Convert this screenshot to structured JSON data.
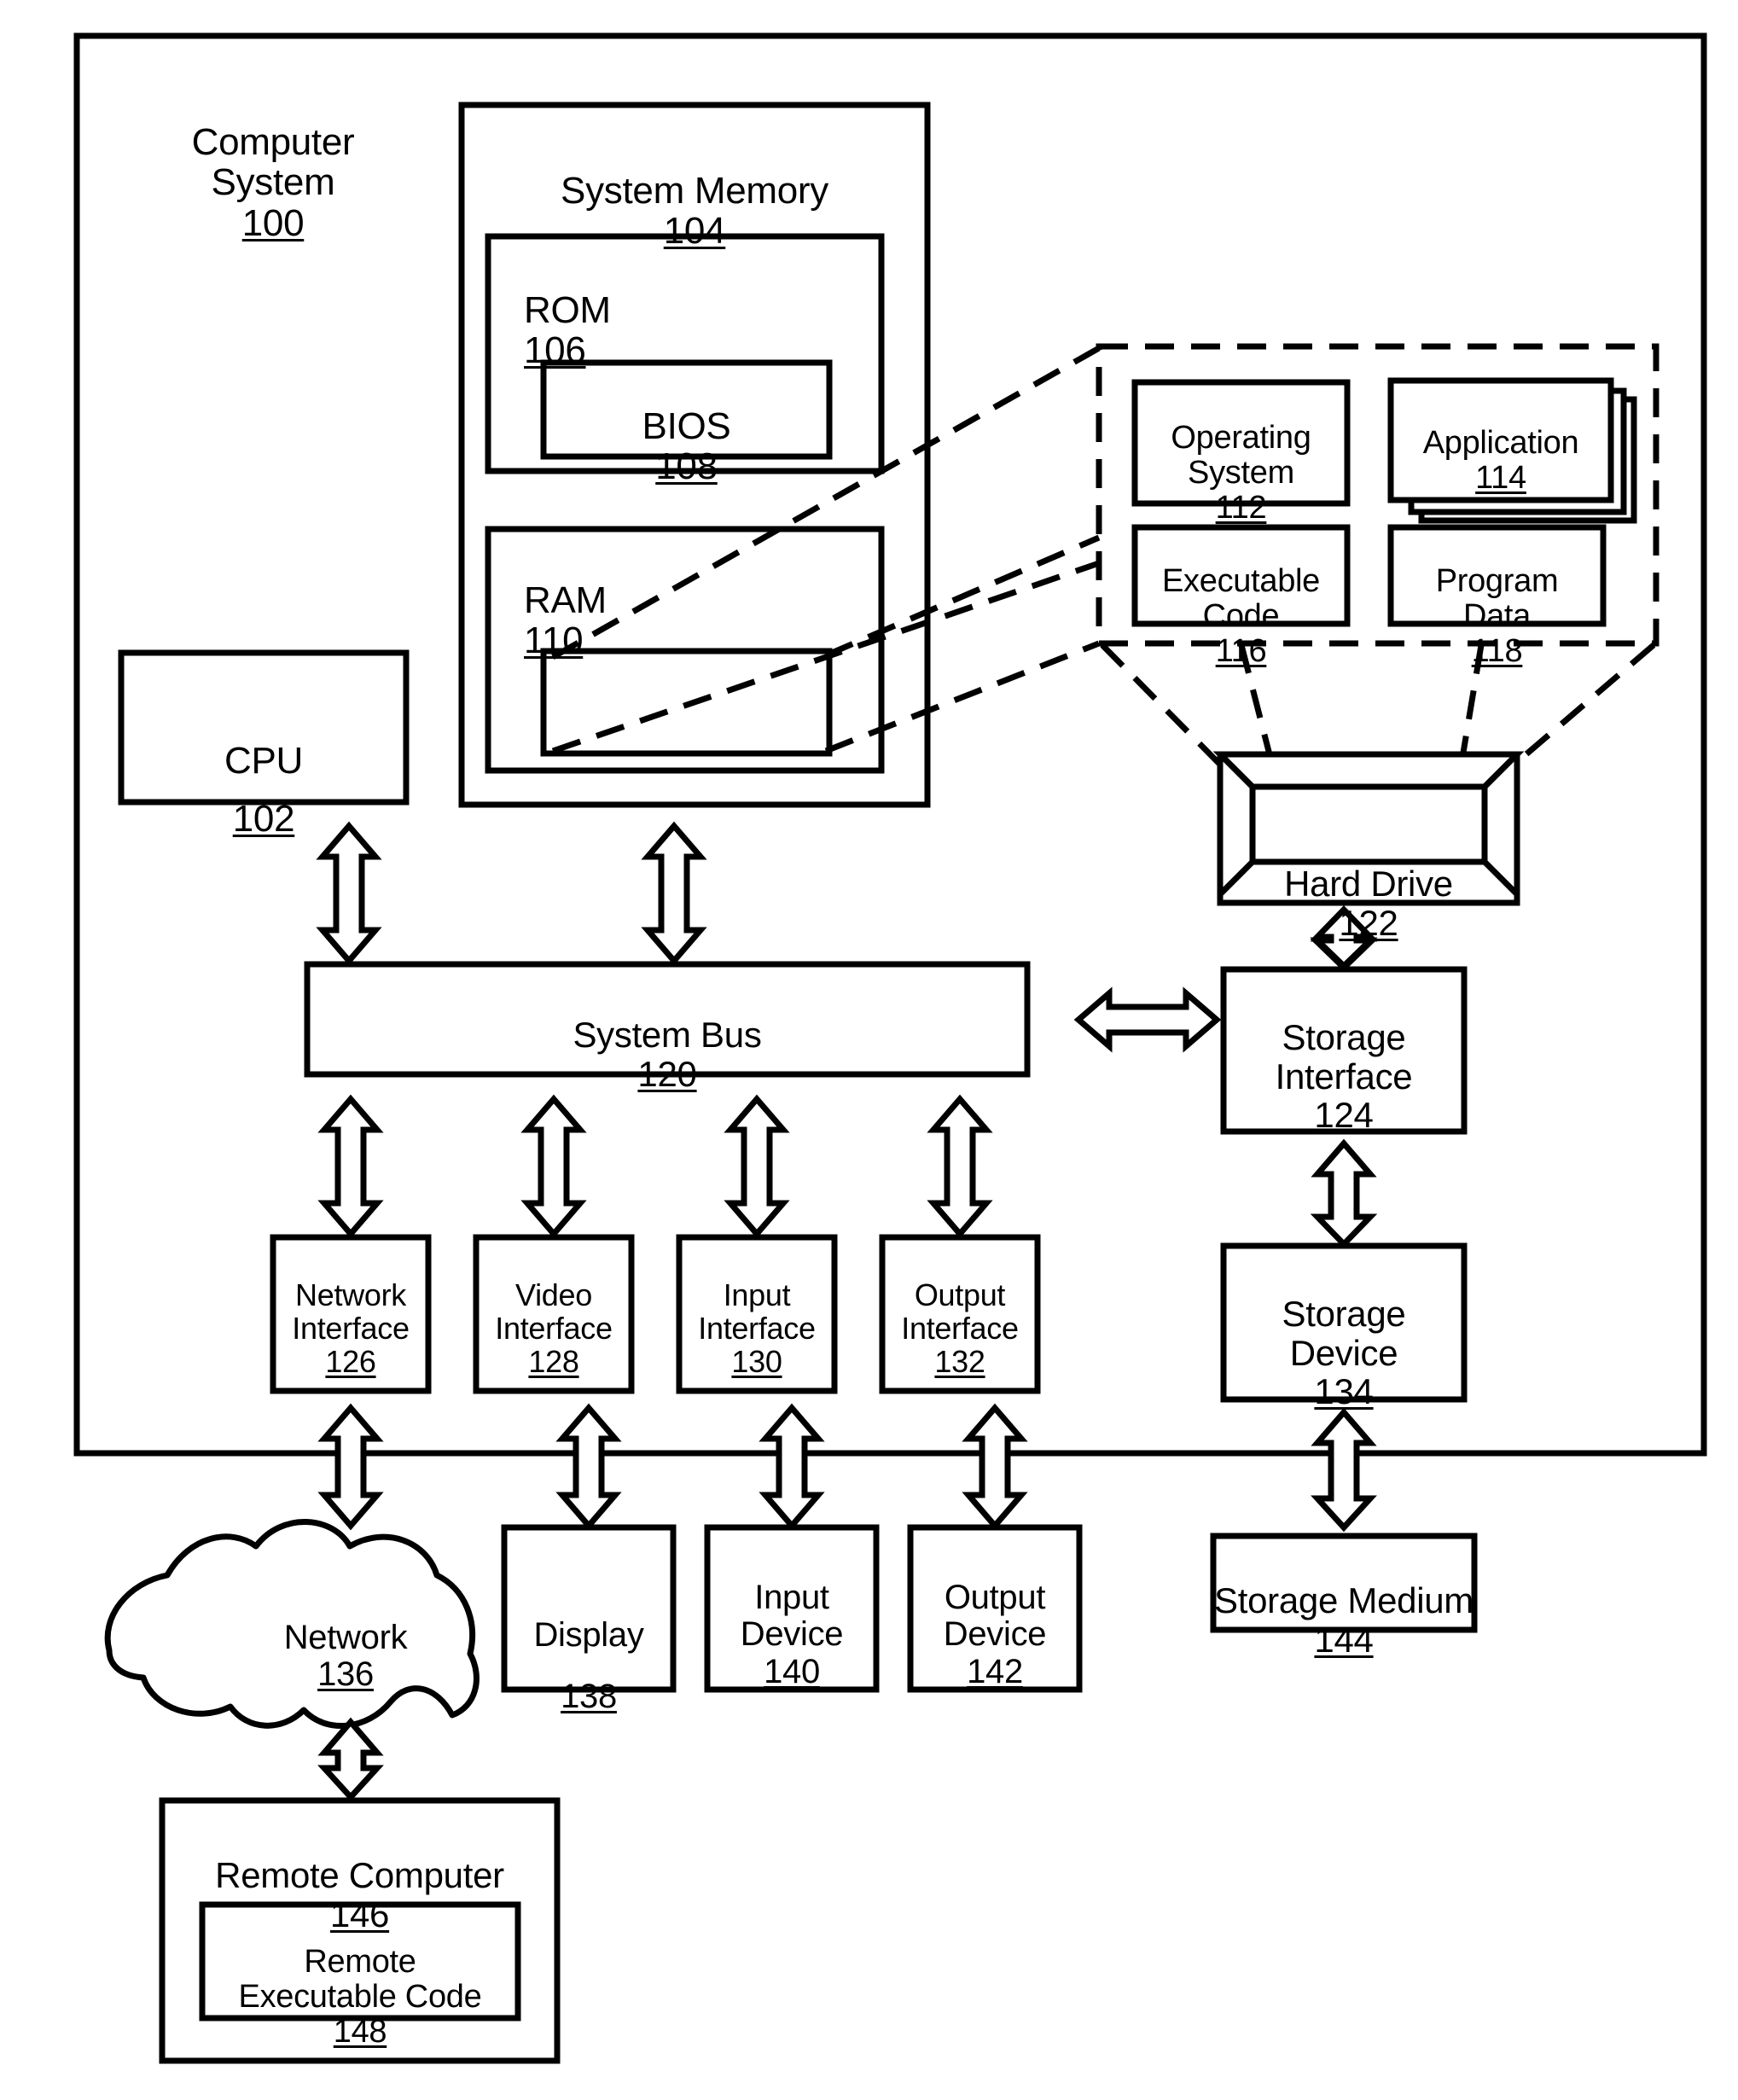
{
  "figure": {
    "type": "patent-block-diagram",
    "title": "Computer System block diagram",
    "line_color": "#000000",
    "background_color": "#ffffff"
  },
  "outer": {
    "label": "Computer System",
    "number": "100"
  },
  "system_memory": {
    "label": "System Memory",
    "number": "104",
    "rom": {
      "label": "ROM",
      "number": "106",
      "bios": {
        "label": "BIOS",
        "number": "108"
      }
    },
    "ram": {
      "label": "RAM",
      "number": "110",
      "inner": {
        "label": "",
        "number": ""
      }
    }
  },
  "cpu": {
    "label": "CPU",
    "number": "102"
  },
  "callout": {
    "operating_system": {
      "label": "Operating\nSystem",
      "number": "112"
    },
    "application": {
      "label": "Application",
      "number": "114"
    },
    "executable_code": {
      "label": "Executable\nCode",
      "number": "116"
    },
    "program_data": {
      "label": "Program\nData",
      "number": "118"
    }
  },
  "hard_drive": {
    "label": "Hard Drive",
    "number": "122"
  },
  "system_bus": {
    "label": "System Bus",
    "number": "120"
  },
  "storage_interface": {
    "label": "Storage\nInterface",
    "number": "124"
  },
  "storage_device": {
    "label": "Storage\nDevice",
    "number": "134"
  },
  "storage_medium": {
    "label": "Storage Medium",
    "number": "144"
  },
  "interfaces": [
    {
      "label": "Network\nInterface",
      "number": "126"
    },
    {
      "label": "Video\nInterface",
      "number": "128"
    },
    {
      "label": "Input\nInterface",
      "number": "130"
    },
    {
      "label": "Output\nInterface",
      "number": "132"
    }
  ],
  "devices": [
    {
      "label": "Network",
      "number": "136"
    },
    {
      "label": "Display",
      "number": "138"
    },
    {
      "label": "Input\nDevice",
      "number": "140"
    },
    {
      "label": "Output\nDevice",
      "number": "142"
    }
  ],
  "remote": {
    "label": "Remote Computer",
    "number": "146",
    "code": {
      "label": "Remote\nExecutable Code",
      "number": "148"
    }
  }
}
